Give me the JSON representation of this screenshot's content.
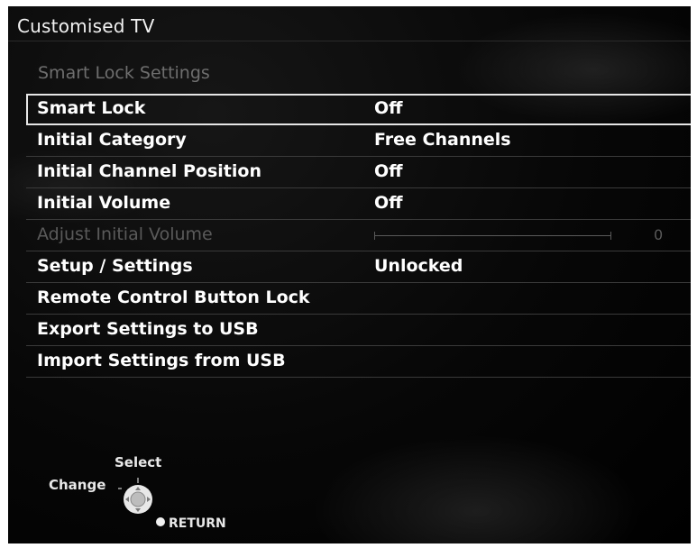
{
  "app": {
    "title": "Customised TV"
  },
  "section": {
    "title": "Smart Lock Settings"
  },
  "menu": {
    "items": [
      {
        "label": "Smart Lock",
        "value": "Off"
      },
      {
        "label": "Initial Category",
        "value": "Free Channels"
      },
      {
        "label": "Initial Channel Position",
        "value": "Off"
      },
      {
        "label": "Initial Volume",
        "value": "Off"
      },
      {
        "label": "Adjust Initial Volume",
        "slider_value": "0",
        "slider_level": 0
      },
      {
        "label": "Setup / Settings",
        "value": "Unlocked"
      },
      {
        "label": "Remote Control Button Lock"
      },
      {
        "label": "Export Settings to USB"
      },
      {
        "label": "Import Settings from USB"
      }
    ],
    "selected_index": 0
  },
  "help": {
    "select_label": "Select",
    "change_label": "Change",
    "return_label": "RETURN",
    "icon": "dpad-icon"
  },
  "colors": {
    "background": "#000000",
    "text": "#ffffff",
    "disabled_text": "#5a5a5a",
    "selection_border": "#e6e6e6"
  }
}
